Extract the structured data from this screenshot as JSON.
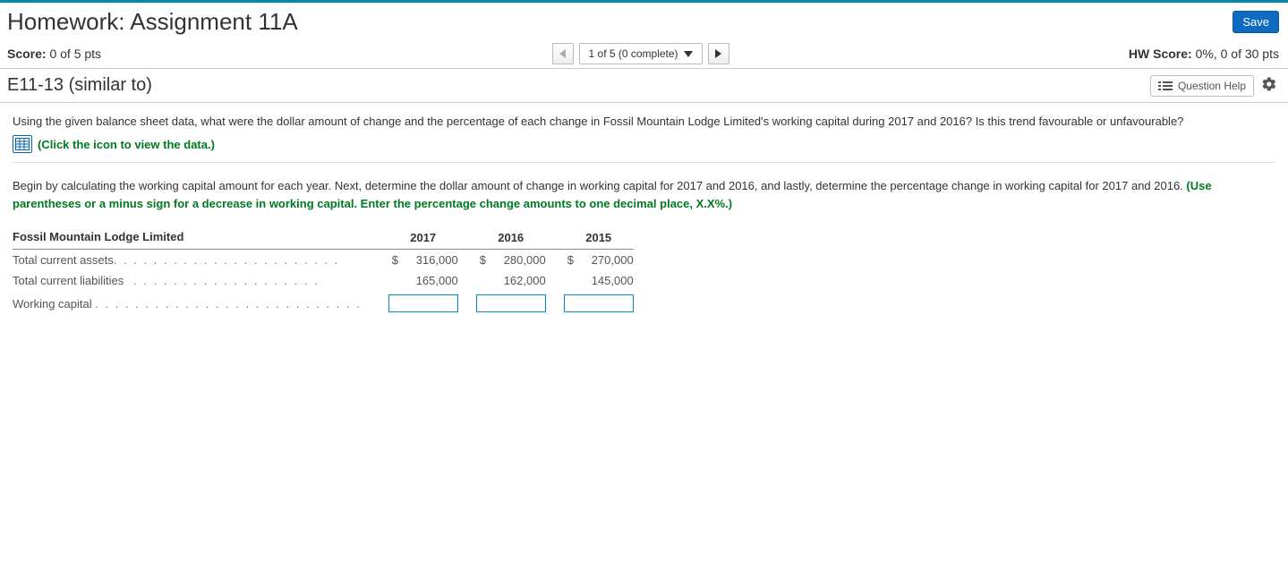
{
  "header": {
    "title": "Homework: Assignment 11A",
    "save_label": "Save"
  },
  "score_bar": {
    "score_label": "Score:",
    "score_value": "0 of 5 pts",
    "nav_position": "1 of 5 (0 complete)",
    "hw_score_label": "HW Score:",
    "hw_score_value": "0%, 0 of 30 pts"
  },
  "question_bar": {
    "question_id": "E11-13 (similar to)",
    "help_label": "Question Help"
  },
  "question": {
    "prompt": "Using the given balance sheet data, what were the dollar amount of change and the percentage of each change in Fossil Mountain Lodge Limited's working capital during 2017 and 2016? Is this trend favourable or unfavourable?",
    "data_link": "(Click the icon to view the data.)",
    "instructions_plain": "Begin by calculating the working capital amount for each year. Next, determine the dollar amount of change in working capital for 2017 and 2016, and lastly, determine the percentage change in working capital for 2017 and 2016. ",
    "instructions_hint": "(Use parentheses or a minus sign for a decrease in working capital. Enter the percentage change amounts to one decimal place, X.X%.)"
  },
  "table": {
    "company": "Fossil Mountain Lodge Limited",
    "years": [
      "2017",
      "2016",
      "2015"
    ],
    "rows": [
      {
        "label": "Total current assets",
        "currency": true,
        "values": [
          "316,000",
          "280,000",
          "270,000"
        ]
      },
      {
        "label": "Total current liabilities",
        "currency": false,
        "values": [
          "165,000",
          "162,000",
          "145,000"
        ]
      }
    ],
    "input_row_label": "Working capital"
  }
}
